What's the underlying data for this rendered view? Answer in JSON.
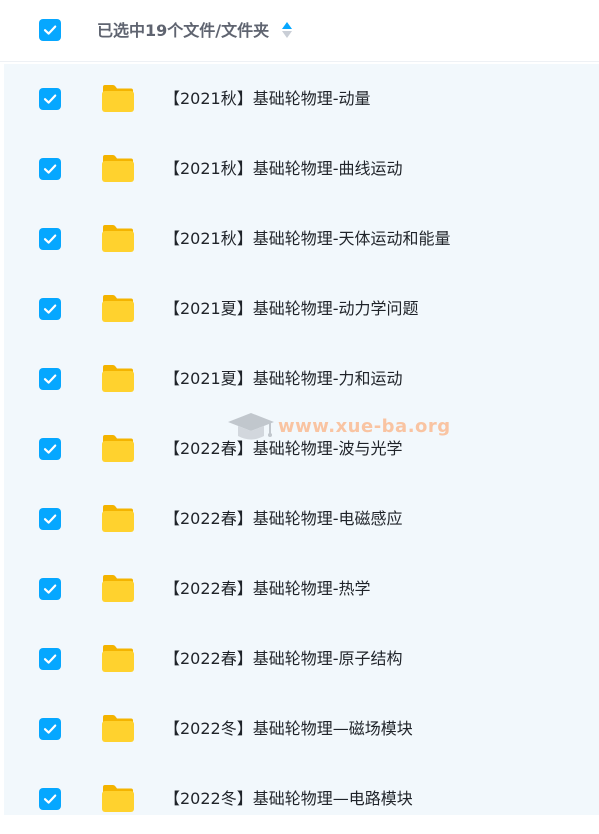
{
  "header": {
    "selection_summary": "已选中19个文件/文件夹",
    "select_all_checked": true
  },
  "colors": {
    "checkbox": "#06a7ff",
    "folder_body": "#ffd22e",
    "folder_tab": "#f4b400",
    "row_background": "#f2f8fc",
    "text": "#1f2329",
    "header_text": "#5f6470"
  },
  "watermark": {
    "text": "www.xue-ba.org"
  },
  "files": [
    {
      "name": "【2021秋】基础轮物理-动量",
      "type": "folder",
      "checked": true
    },
    {
      "name": "【2021秋】基础轮物理-曲线运动",
      "type": "folder",
      "checked": true
    },
    {
      "name": "【2021秋】基础轮物理-天体运动和能量",
      "type": "folder",
      "checked": true
    },
    {
      "name": "【2021夏】基础轮物理-动力学问题",
      "type": "folder",
      "checked": true
    },
    {
      "name": "【2021夏】基础轮物理-力和运动",
      "type": "folder",
      "checked": true
    },
    {
      "name": "【2022春】基础轮物理-波与光学",
      "type": "folder",
      "checked": true
    },
    {
      "name": "【2022春】基础轮物理-电磁感应",
      "type": "folder",
      "checked": true
    },
    {
      "name": "【2022春】基础轮物理-热学",
      "type": "folder",
      "checked": true
    },
    {
      "name": "【2022春】基础轮物理-原子结构",
      "type": "folder",
      "checked": true
    },
    {
      "name": "【2022冬】基础轮物理—磁场模块",
      "type": "folder",
      "checked": true
    },
    {
      "name": "【2022冬】基础轮物理—电路模块",
      "type": "folder",
      "checked": true
    }
  ]
}
